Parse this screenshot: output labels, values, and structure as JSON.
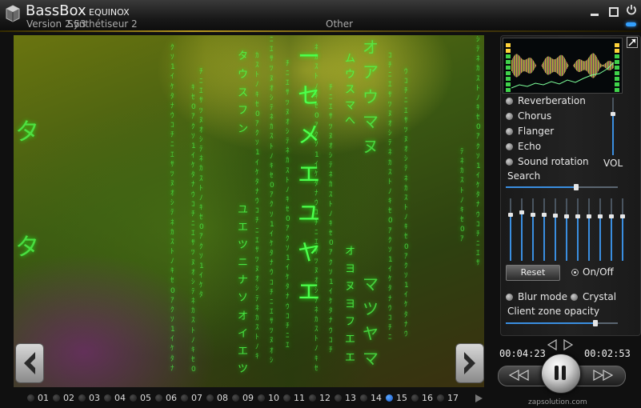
{
  "window": {
    "title": "BassBox",
    "subtitle": "EQUINOX",
    "version": "Version 2.53",
    "preset": "Synthétiseur 2",
    "category": "Other"
  },
  "panel": {
    "effects": [
      "Reverberation",
      "Chorus",
      "Flanger",
      "Echo",
      "Sound rotation"
    ],
    "volume_label": "VOL",
    "volume_level": 0.72,
    "search_label": "Search",
    "search_position": 0.63,
    "eq_levels": [
      0.75,
      0.78,
      0.75,
      0.74,
      0.73,
      0.72,
      0.72,
      0.72,
      0.72,
      0.72,
      0.72
    ],
    "reset_label": "Reset",
    "onoff_label": "On/Off",
    "blur_label": "Blur mode",
    "crystal_label": "Crystal",
    "opacity_label": "Client zone opacity",
    "opacity_level": 0.8
  },
  "transport": {
    "elapsed": "00:04:23",
    "remaining": "00:02:53",
    "brand": "zapsolution.com"
  },
  "tracks": {
    "items": [
      "01",
      "02",
      "03",
      "04",
      "05",
      "06",
      "07",
      "08",
      "09",
      "10",
      "11",
      "12",
      "13",
      "14",
      "15",
      "16",
      "17"
    ],
    "active_index": 14
  },
  "video": {
    "matrix_columns": [
      "タ\nタ\nタ",
      "ー\nセ\nメ\nエ\nユ\nヤ\nエ",
      "オ\nア\nウ\nマ\nヌ",
      "マ\nツ\nヤ\nマ",
      "タ\nウ\nス\nフ\nン",
      "ユ\nエ\nツ\nニ\nナ\nソ\nオ\nイ\nエ\nツ",
      "ム\nウ\nス\nマ\nへ",
      "オ\nヨ\nヌ\nヨ\nフ\nエ\nエ"
    ],
    "colors": {
      "matrix": "#4dff4d",
      "accent": "#3a8ee0"
    }
  }
}
